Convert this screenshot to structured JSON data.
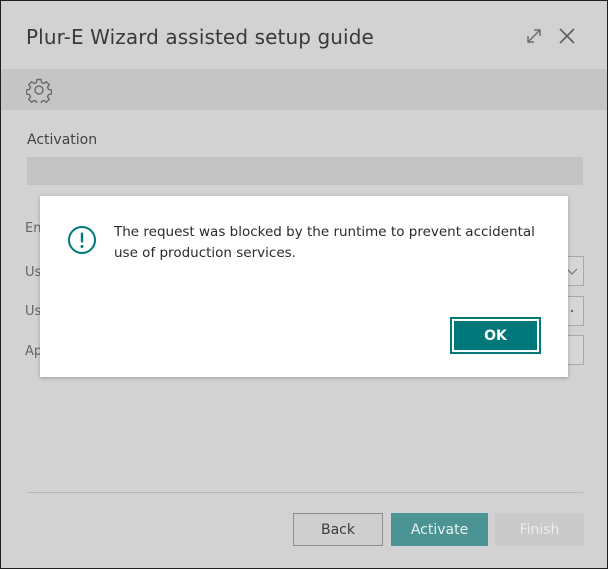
{
  "window": {
    "title": "Plur-E Wizard assisted setup guide",
    "expand_icon": "expand-icon",
    "close_icon": "close-icon"
  },
  "toolbar": {
    "settings_icon": "gear-icon"
  },
  "form": {
    "activation_label": "Activation",
    "activation_value": "",
    "partial_rows": [
      {
        "label": "En"
      },
      {
        "label": "Us"
      },
      {
        "label": "Us"
      },
      {
        "label": "Ap"
      }
    ]
  },
  "footer": {
    "back_label": "Back",
    "activate_label": "Activate",
    "finish_label": "Finish"
  },
  "dialog": {
    "icon": "info-circle-icon",
    "message": "The request was blocked by the runtime to prevent accidental use of production services.",
    "ok_label": "OK"
  },
  "colors": {
    "accent": "#00787a",
    "activate_button": "#4c9393",
    "overlay_background": "#d2d2d2"
  }
}
